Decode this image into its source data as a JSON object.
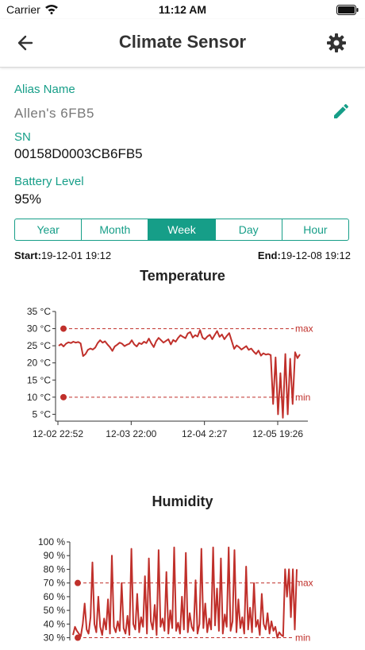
{
  "status_bar": {
    "carrier": "Carrier",
    "time": "11:12 AM"
  },
  "nav": {
    "title": "Climate Sensor",
    "back_icon": "arrow-back-icon",
    "settings_icon": "gear-icon"
  },
  "device": {
    "alias_label": "Alias Name",
    "alias_value": "Allen's 6FB5",
    "sn_label": "SN",
    "sn_value": "00158D0003CB6FB5",
    "battery_label": "Battery Level",
    "battery_value": "95%"
  },
  "tabs": [
    {
      "label": "Year",
      "active": false
    },
    {
      "label": "Month",
      "active": false
    },
    {
      "label": "Week",
      "active": true
    },
    {
      "label": "Day",
      "active": false
    },
    {
      "label": "Hour",
      "active": false
    }
  ],
  "range": {
    "start_label": "Start:",
    "start_value": "19-12-01 19:12",
    "end_label": "End:",
    "end_value": "19-12-08 19:12"
  },
  "colors": {
    "accent": "#169e88",
    "series": "#c0302b"
  },
  "chart_data": [
    {
      "type": "line",
      "title": "Temperature",
      "y_ticks": [
        "5 °C",
        "10 °C",
        "15 °C",
        "20 °C",
        "25 °C",
        "30 °C",
        "35 °C"
      ],
      "x_ticks": [
        "12-02 22:52",
        "12-03 22:00",
        "12-04 2:27",
        "12-05 19:26"
      ],
      "ylim": [
        3,
        35
      ],
      "max_threshold": 30,
      "min_threshold": 10,
      "max_label": "max",
      "min_label": "min",
      "series": [
        {
          "values": [
            25,
            25.5,
            24.8,
            25.6,
            26,
            25.8,
            26.2,
            25.9,
            26.1,
            25.7,
            22,
            22.6,
            23.8,
            24.2,
            23.9,
            24.5,
            25.8,
            26.6,
            25.9,
            26.3,
            25.4,
            24.6,
            23.5,
            24.8,
            25.3,
            25.9,
            25.6,
            24.9,
            25.3,
            25.6,
            26.6,
            25.4,
            24.8,
            25.8,
            25.5,
            26.2,
            25.8,
            27.1,
            25.7,
            24.6,
            26.3,
            27.3,
            26.6,
            25.9,
            26.4,
            26.9,
            25.4,
            26.7,
            26.2,
            27.3,
            28.1,
            27.6,
            27.2,
            28.6,
            29,
            27.4,
            28.1,
            27.7,
            29.6,
            27.4,
            26.9,
            27.7,
            28.2,
            26.9,
            28.1,
            29.3,
            27.6,
            28.3,
            26.9,
            27.9,
            28.7,
            26.4,
            24.1,
            25.1,
            24.6,
            23.9,
            24.4,
            24.9,
            23.8,
            24.2,
            23.3,
            22.6,
            23.6,
            22.1,
            22.8,
            22.4,
            22.6,
            22.3,
            8,
            21.6,
            5,
            17,
            4,
            22.6,
            5,
            21.2,
            8,
            23.1,
            21.4,
            22.5
          ]
        }
      ]
    },
    {
      "type": "line",
      "title": "Humidity",
      "y_ticks": [
        "30 %",
        "40 %",
        "50 %",
        "60 %",
        "70 %",
        "80 %",
        "90 %",
        "100 %"
      ],
      "x_ticks": [],
      "ylim": [
        28,
        100
      ],
      "max_threshold": 70,
      "min_threshold": 30,
      "max_label": "max",
      "min_label": "min",
      "series": [
        {
          "values": [
            32,
            38,
            35,
            33,
            31,
            40,
            55,
            36,
            33,
            45,
            85,
            40,
            34,
            60,
            38,
            32,
            44,
            36,
            58,
            33,
            90,
            38,
            34,
            42,
            35,
            70,
            37,
            33,
            46,
            32,
            95,
            40,
            36,
            62,
            34,
            45,
            38,
            75,
            33,
            88,
            42,
            36,
            54,
            32,
            94,
            38,
            44,
            35,
            78,
            33,
            50,
            37,
            96,
            35,
            41,
            33,
            60,
            36,
            92,
            34,
            48,
            38,
            35,
            72,
            33,
            40,
            95,
            37,
            55,
            34,
            44,
            36,
            96,
            39,
            66,
            35,
            88,
            33,
            47,
            38,
            96,
            35,
            42,
            94,
            34,
            58,
            37,
            45,
            33,
            82,
            36,
            52,
            34,
            70,
            38,
            43,
            32,
            62,
            40,
            36,
            48,
            33,
            42,
            35,
            38,
            30,
            34,
            32,
            31,
            80,
            60,
            80,
            45,
            80,
            36,
            80
          ]
        }
      ]
    }
  ]
}
